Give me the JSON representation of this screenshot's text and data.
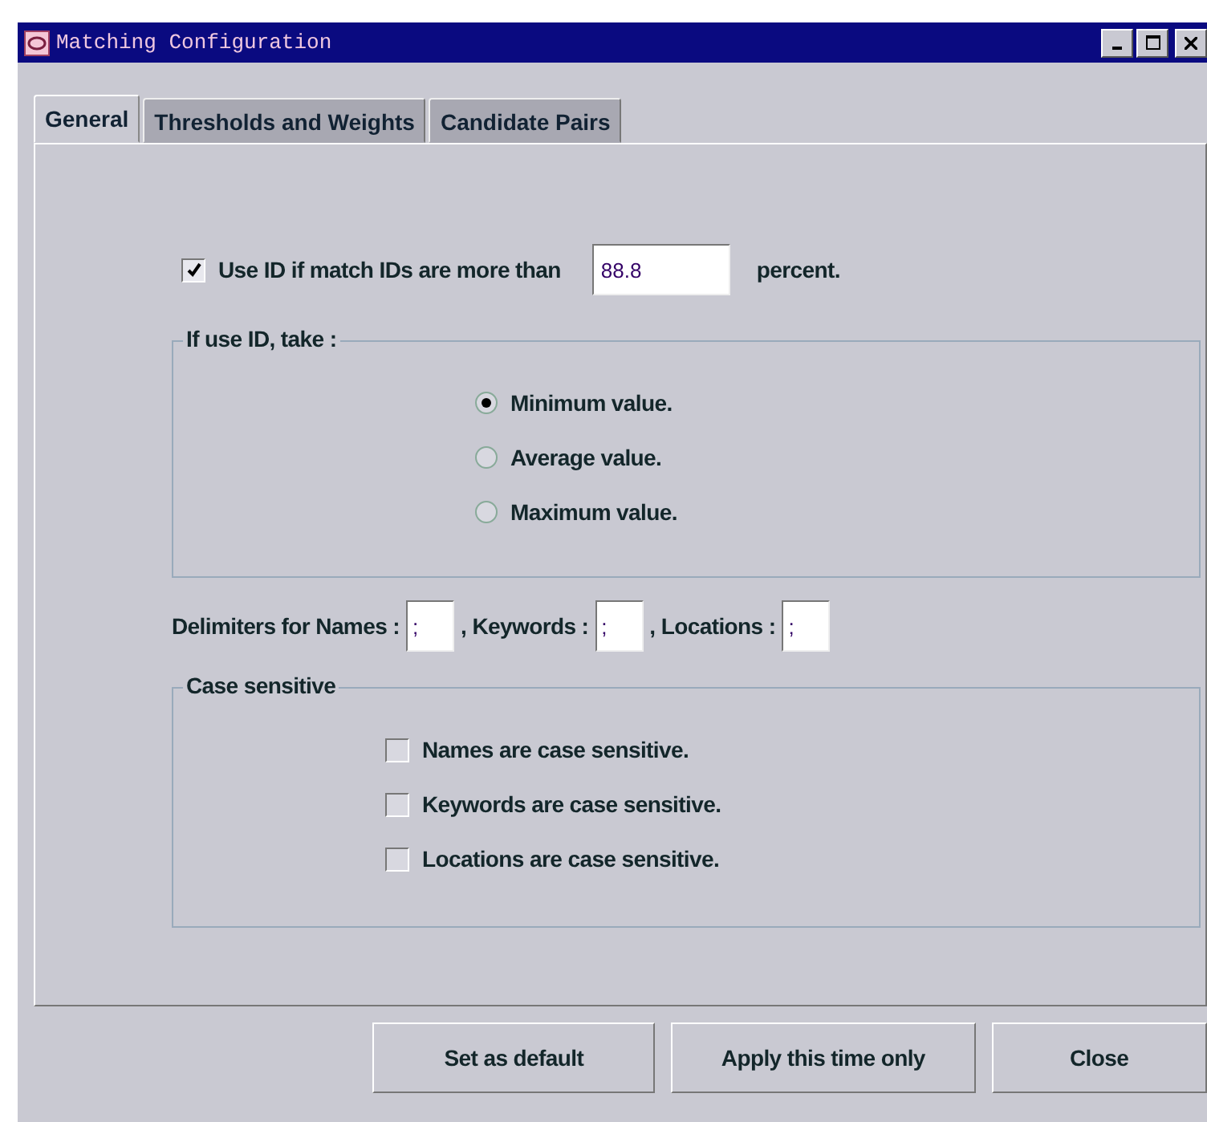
{
  "window": {
    "title": "Matching Configuration"
  },
  "tabs": [
    {
      "label": "General",
      "selected": true
    },
    {
      "label": "Thresholds and Weights",
      "selected": false
    },
    {
      "label": "Candidate Pairs",
      "selected": false
    }
  ],
  "use_id": {
    "label": "Use ID if match IDs are more than",
    "checked": true,
    "value": "88.8",
    "suffix": "percent."
  },
  "take_group": {
    "title": "If use ID, take :",
    "options": [
      {
        "label": "Minimum value.",
        "selected": true
      },
      {
        "label": "Average value.",
        "selected": false
      },
      {
        "label": "Maximum value.",
        "selected": false
      }
    ]
  },
  "delimiters": [
    {
      "label": "Delimiters for Names :",
      "value": ";"
    },
    {
      "label": ", Keywords :",
      "value": ";"
    },
    {
      "label": ", Locations :",
      "value": ";"
    }
  ],
  "case_group": {
    "title": "Case sensitive",
    "options": [
      {
        "label": "Names are case sensitive.",
        "checked": false
      },
      {
        "label": "Keywords are case sensitive.",
        "checked": false
      },
      {
        "label": "Locations are case sensitive.",
        "checked": false
      }
    ]
  },
  "buttons": [
    "Set as default",
    "Apply this time only",
    "Close"
  ]
}
